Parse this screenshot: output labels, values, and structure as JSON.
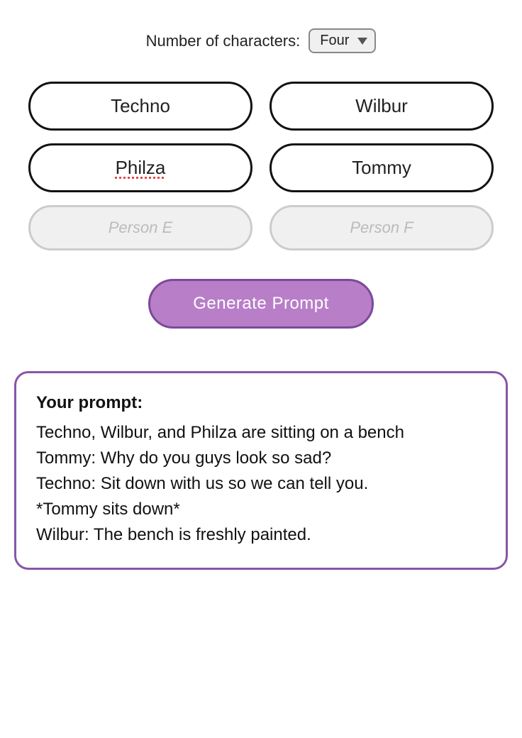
{
  "header": {
    "num_characters_label": "Number of characters:",
    "selected_value": "Four"
  },
  "characters": {
    "slot_a": "Techno",
    "slot_b": "Wilbur",
    "slot_c": "Philza",
    "slot_d": "Tommy",
    "slot_e": "Person E",
    "slot_f": "Person F"
  },
  "generate_button": {
    "label": "Generate Prompt"
  },
  "prompt_box": {
    "label": "Your prompt:",
    "content": "Techno, Wilbur, and Philza are sitting on a bench\nTommy: Why do you guys look so sad?\nTechno: Sit down with us so we can tell you.\n*Tommy sits down*\nWilbur: The bench is freshly painted."
  }
}
